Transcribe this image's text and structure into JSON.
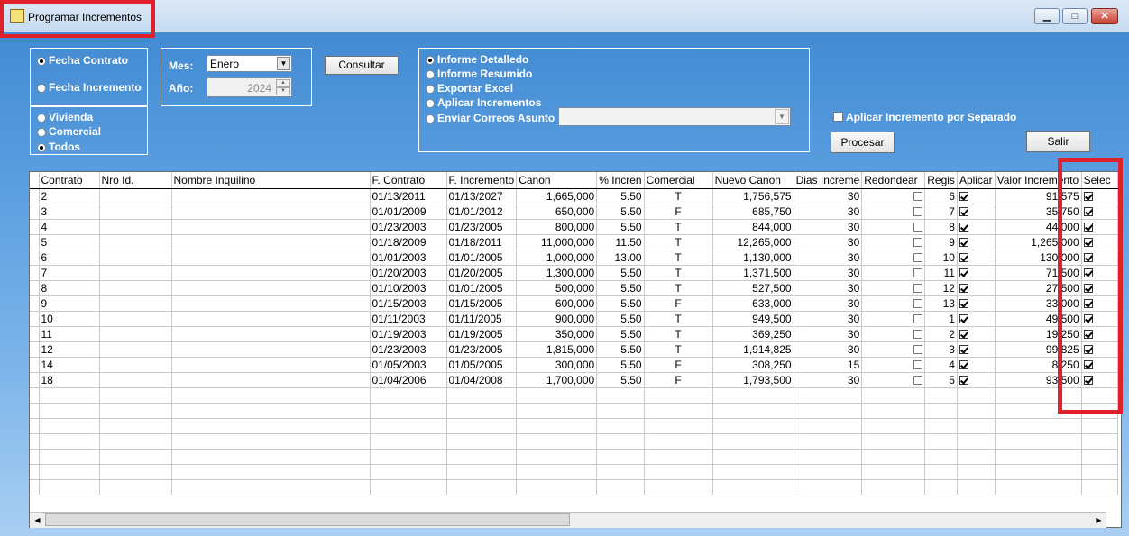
{
  "window": {
    "title": "Programar Incrementos",
    "buttons": {
      "minimize": "▁",
      "maximize": "□",
      "close": "✕"
    }
  },
  "date_filter": {
    "options": [
      "Fecha Contrato",
      "Fecha Incremento"
    ],
    "selected": "Fecha Contrato"
  },
  "type_filter": {
    "options": [
      "Vivienda",
      "Comercial",
      "Todos"
    ],
    "selected": "Todos"
  },
  "period": {
    "mes_label": "Mes:",
    "mes_value": "Enero",
    "anio_label": "Año:",
    "anio_value": "2024"
  },
  "consultar_label": "Consultar",
  "report_options": {
    "options": [
      "Informe Detalledo",
      "Informe Resumido",
      "Exportar Excel",
      "Aplicar Incrementos",
      "Enviar Correos Asunto"
    ],
    "selected": "Informe Detalledo",
    "asunto_value": ""
  },
  "separado_label": "Aplicar Incremento por Separado",
  "procesar_label": "Procesar",
  "salir_label": "Salir",
  "grid": {
    "columns": [
      "Contrato",
      "Nro Id.",
      "Nombre Inquilino",
      "F. Contrato",
      "F. Incremento",
      "Canon",
      "% Incren",
      "Comercial",
      "Nuevo Canon",
      "Dias Increme",
      "Redondear",
      "Regis",
      "Aplicar",
      "Valor Incremento",
      "Selec"
    ],
    "rows": [
      {
        "contrato": "2",
        "nro": "",
        "nombre": "",
        "fcontrato": "01/13/2011",
        "fincremento": "01/13/2027",
        "canon": "1,665,000",
        "pct": "5.50",
        "comercial": "T",
        "nuevo": "1,756,575",
        "dias": "30",
        "regis": "6",
        "valor": "91,575"
      },
      {
        "contrato": "3",
        "nro": "",
        "nombre": "",
        "fcontrato": "01/01/2009",
        "fincremento": "01/01/2012",
        "canon": "650,000",
        "pct": "5.50",
        "comercial": "F",
        "nuevo": "685,750",
        "dias": "30",
        "regis": "7",
        "valor": "35,750"
      },
      {
        "contrato": "4",
        "nro": "",
        "nombre": "",
        "fcontrato": "01/23/2003",
        "fincremento": "01/23/2005",
        "canon": "800,000",
        "pct": "5.50",
        "comercial": "T",
        "nuevo": "844,000",
        "dias": "30",
        "regis": "8",
        "valor": "44,000"
      },
      {
        "contrato": "5",
        "nro": "",
        "nombre": "",
        "fcontrato": "01/18/2009",
        "fincremento": "01/18/2011",
        "canon": "11,000,000",
        "pct": "11.50",
        "comercial": "T",
        "nuevo": "12,265,000",
        "dias": "30",
        "regis": "9",
        "valor": "1,265,000"
      },
      {
        "contrato": "6",
        "nro": "",
        "nombre": "",
        "fcontrato": "01/01/2003",
        "fincremento": "01/01/2005",
        "canon": "1,000,000",
        "pct": "13.00",
        "comercial": "T",
        "nuevo": "1,130,000",
        "dias": "30",
        "regis": "10",
        "valor": "130,000"
      },
      {
        "contrato": "7",
        "nro": "",
        "nombre": "",
        "fcontrato": "01/20/2003",
        "fincremento": "01/20/2005",
        "canon": "1,300,000",
        "pct": "5.50",
        "comercial": "T",
        "nuevo": "1,371,500",
        "dias": "30",
        "regis": "11",
        "valor": "71,500"
      },
      {
        "contrato": "8",
        "nro": "",
        "nombre": "",
        "fcontrato": "01/10/2003",
        "fincremento": "01/01/2005",
        "canon": "500,000",
        "pct": "5.50",
        "comercial": "T",
        "nuevo": "527,500",
        "dias": "30",
        "regis": "12",
        "valor": "27,500"
      },
      {
        "contrato": "9",
        "nro": "",
        "nombre": "",
        "fcontrato": "01/15/2003",
        "fincremento": "01/15/2005",
        "canon": "600,000",
        "pct": "5.50",
        "comercial": "F",
        "nuevo": "633,000",
        "dias": "30",
        "regis": "13",
        "valor": "33,000"
      },
      {
        "contrato": "10",
        "nro": "",
        "nombre": "",
        "fcontrato": "01/11/2003",
        "fincremento": "01/11/2005",
        "canon": "900,000",
        "pct": "5.50",
        "comercial": "T",
        "nuevo": "949,500",
        "dias": "30",
        "regis": "1",
        "valor": "49,500"
      },
      {
        "contrato": "11",
        "nro": "",
        "nombre": "",
        "fcontrato": "01/19/2003",
        "fincremento": "01/19/2005",
        "canon": "350,000",
        "pct": "5.50",
        "comercial": "T",
        "nuevo": "369,250",
        "dias": "30",
        "regis": "2",
        "valor": "19,250"
      },
      {
        "contrato": "12",
        "nro": "",
        "nombre": "",
        "fcontrato": "01/23/2003",
        "fincremento": "01/23/2005",
        "canon": "1,815,000",
        "pct": "5.50",
        "comercial": "T",
        "nuevo": "1,914,825",
        "dias": "30",
        "regis": "3",
        "valor": "99,825"
      },
      {
        "contrato": "14",
        "nro": "",
        "nombre": "",
        "fcontrato": "01/05/2003",
        "fincremento": "01/05/2005",
        "canon": "300,000",
        "pct": "5.50",
        "comercial": "F",
        "nuevo": "308,250",
        "dias": "15",
        "regis": "4",
        "valor": "8,250"
      },
      {
        "contrato": "18",
        "nro": "",
        "nombre": "",
        "fcontrato": "01/04/2006",
        "fincremento": "01/04/2008",
        "canon": "1,700,000",
        "pct": "5.50",
        "comercial": "F",
        "nuevo": "1,793,500",
        "dias": "30",
        "regis": "5",
        "valor": "93,500"
      }
    ],
    "empty_rows": 7
  },
  "colors": {
    "highlight": "#e0202a",
    "accent": "#3e86cf"
  }
}
